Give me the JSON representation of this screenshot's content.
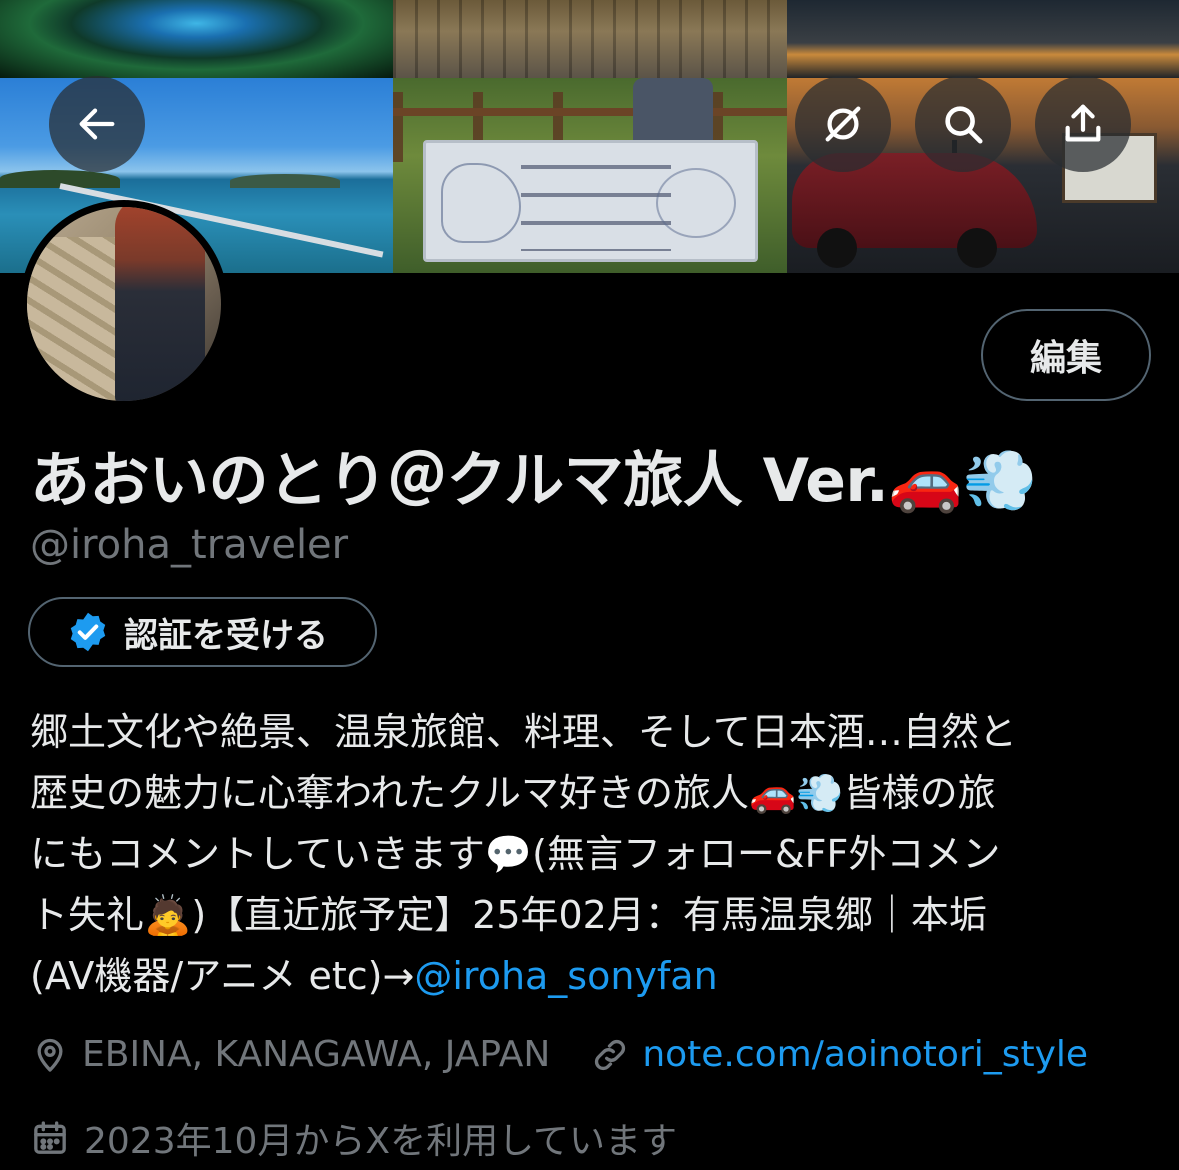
{
  "header": {
    "back_icon": "arrow-left-icon",
    "grok_icon": "grok-icon",
    "search_icon": "search-icon",
    "share_icon": "share-icon"
  },
  "profile": {
    "edit_label": "編集",
    "display_name": "あおいのとり＠クルマ旅人 Ver.🚗💨",
    "handle": "@iroha_traveler",
    "verify_label": "認証を受ける",
    "bio_lines": [
      "郷土文化や絶景、温泉旅館、料理、そして日本酒…自然と",
      "歴史の魅力に心奪われたクルマ好きの旅人🚗💨皆様の旅",
      "にもコメントしていきます💬(無言フォロー&FF外コメン",
      "ト失礼🙇)【直近旅予定】25年02月：有馬温泉郷｜本垢",
      "(AV機器/アニメ etc)→"
    ],
    "bio_mention": "@iroha_sonyfan",
    "location": "EBINA, KANAGAWA, JAPAN",
    "website": "note.com/aoinotori_style",
    "joined": "2023年10月からXを利用しています"
  },
  "colors": {
    "background": "#000000",
    "text": "#e7e9ea",
    "muted": "#71767b",
    "link": "#1d9bf0",
    "border": "#536471"
  }
}
